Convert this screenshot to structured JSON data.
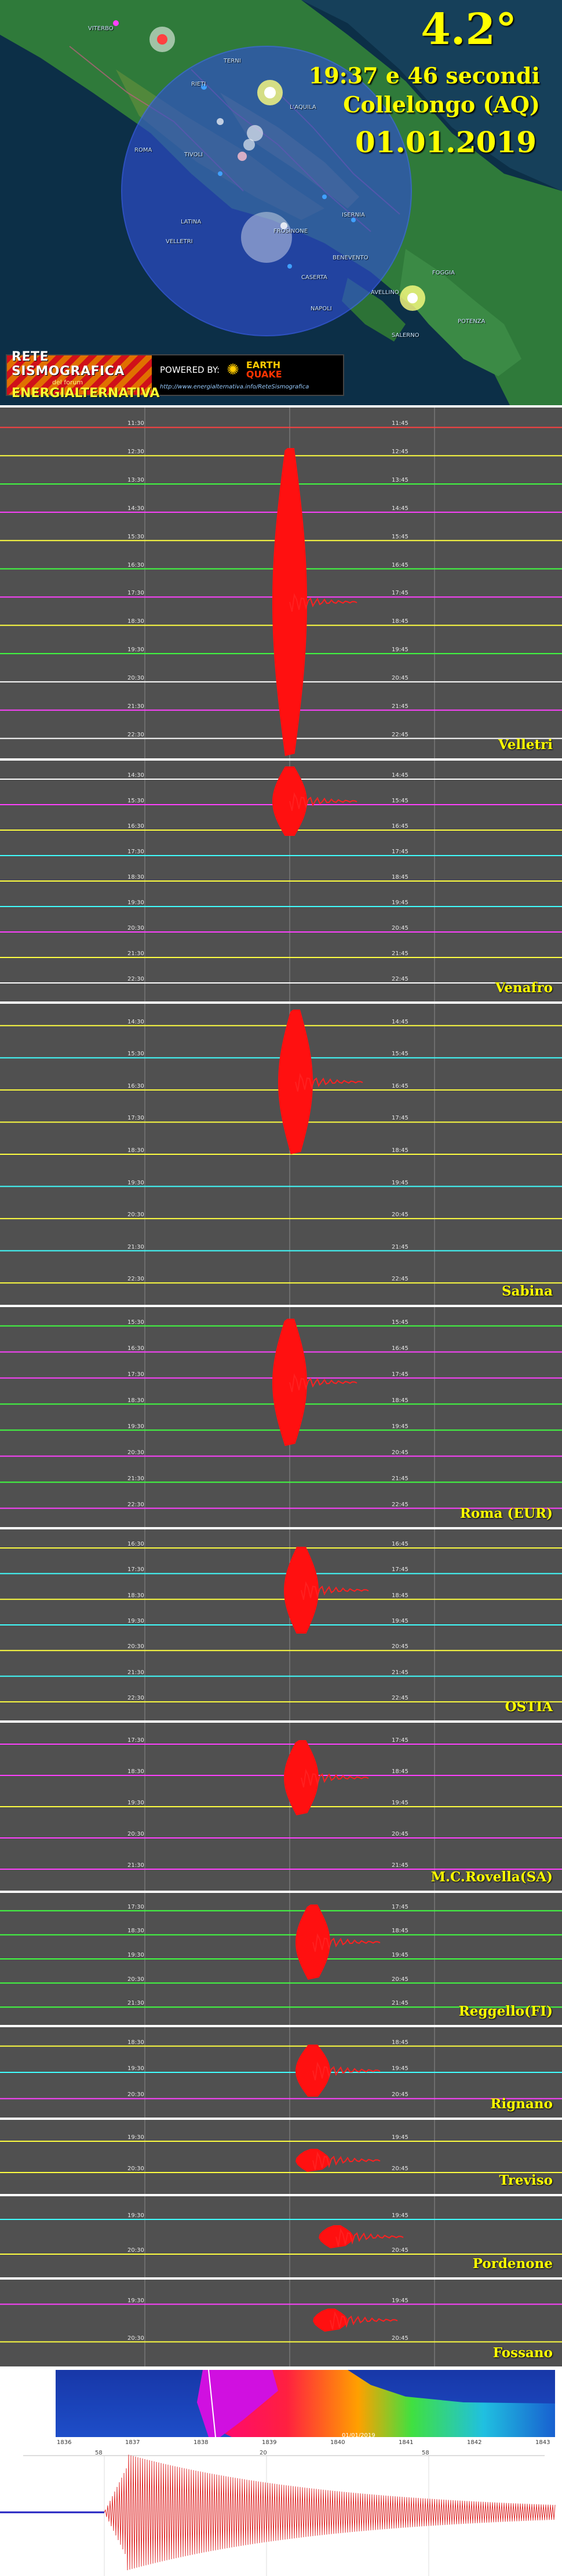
{
  "header": {
    "magnitude": "4.2°",
    "time": "19:37 e 46 secondi",
    "place": "Collelongo (AQ)",
    "date": "01.01.2019",
    "banner": {
      "logo_line1": "RETE SISMOGRAFICA",
      "logo_line2": "del forum",
      "logo_line3": "ENERGIALTERNATIVA",
      "powered_by": "POWERED BY:",
      "eq_logo_top": "EARTH",
      "eq_logo_bottom": "QUAKE",
      "url": "http://www.energialternativa.info/ReteSismografica"
    },
    "cities": [
      {
        "name": "VITERBO"
      },
      {
        "name": "TERNI"
      },
      {
        "name": "RIETI"
      },
      {
        "name": "L'AQUILA"
      },
      {
        "name": "ROMA"
      },
      {
        "name": "TIVOLI"
      },
      {
        "name": "LATINA"
      },
      {
        "name": "FROSINONE"
      },
      {
        "name": "VELLETRI"
      },
      {
        "name": "ISERNIA"
      },
      {
        "name": "BENEVENTO"
      },
      {
        "name": "CASERTA"
      },
      {
        "name": "NAPOLI"
      },
      {
        "name": "FOGGIA"
      },
      {
        "name": "AVELLINO"
      },
      {
        "name": "POTENZA"
      },
      {
        "name": "SALERNO"
      }
    ],
    "colors": {
      "mag_text": "#ffff00",
      "circle": "#2f4fd0"
    }
  },
  "stations": [
    {
      "name": "Velletri",
      "left_ticks": [
        "11:30",
        "12:30",
        "13:30",
        "14:30",
        "15:30",
        "16:30",
        "17:30",
        "18:30",
        "19:30",
        "20:30",
        "21:30",
        "22:30"
      ],
      "right_ticks": [
        "11:45",
        "12:45",
        "13:45",
        "14:45",
        "15:45",
        "16:45",
        "17:45",
        "18:45",
        "19:45",
        "20:45",
        "21:45",
        "22:45"
      ],
      "colors": [
        "#ff4040",
        "#ffff40",
        "#40ff40",
        "#ff40ff",
        "#ffff40",
        "#40ff40",
        "#ff40ff",
        "#ffff40",
        "#40ff40",
        "#ffffff",
        "#ff40ff",
        "#ffffff"
      ]
    },
    {
      "name": "Venafro",
      "left_ticks": [
        "14:30",
        "15:30",
        "16:30",
        "17:30",
        "18:30",
        "19:30",
        "20:30",
        "21:30",
        "22:30"
      ],
      "right_ticks": [
        "14:45",
        "15:45",
        "16:45",
        "17:45",
        "18:45",
        "19:45",
        "20:45",
        "21:45",
        "22:45"
      ],
      "colors": [
        "#ffffff",
        "#ff40ff",
        "#ffff40",
        "#40ffff",
        "#ffff40",
        "#40ffff",
        "#ff40ff",
        "#ffff40",
        "#ffffff"
      ]
    },
    {
      "name": "Sabina",
      "left_ticks": [
        "14:30",
        "15:30",
        "16:30",
        "17:30",
        "18:30",
        "19:30",
        "20:30",
        "21:30",
        "22:30"
      ],
      "right_ticks": [
        "14:45",
        "15:45",
        "16:45",
        "17:45",
        "18:45",
        "19:45",
        "20:45",
        "21:45",
        "22:45"
      ],
      "colors": [
        "#ffff40",
        "#40ffff",
        "#ffff40",
        "#ffff40",
        "#ffff40",
        "#40ffff",
        "#ffff40",
        "#40ffff",
        "#ffff40"
      ]
    },
    {
      "name": "Roma (EUR)",
      "left_ticks": [
        "15:30",
        "16:30",
        "17:30",
        "18:30",
        "19:30",
        "20:30",
        "21:30",
        "22:30"
      ],
      "right_ticks": [
        "15:45",
        "16:45",
        "17:45",
        "18:45",
        "19:45",
        "20:45",
        "21:45",
        "22:45"
      ],
      "colors": [
        "#40ff40",
        "#ff40ff",
        "#ff40ff",
        "#40ff40",
        "#40ff40",
        "#ff40ff",
        "#40ff40",
        "#ff40ff"
      ]
    },
    {
      "name": "OSTIA",
      "left_ticks": [
        "16:30",
        "17:30",
        "18:30",
        "19:30",
        "20:30",
        "21:30",
        "22:30"
      ],
      "right_ticks": [
        "16:45",
        "17:45",
        "18:45",
        "19:45",
        "20:45",
        "21:45",
        "22:45"
      ],
      "colors": [
        "#ffff40",
        "#40ffff",
        "#ffff40",
        "#40ffff",
        "#ffff40",
        "#40ffff",
        "#ffff40"
      ]
    },
    {
      "name": "M.C.Rovella(SA)",
      "left_ticks": [
        "17:30",
        "18:30",
        "19:30",
        "20:30",
        "21:30"
      ],
      "right_ticks": [
        "17:45",
        "18:45",
        "19:45",
        "20:45",
        "21:45"
      ],
      "colors": [
        "#ff40ff",
        "#ff40ff",
        "#ffff40",
        "#ff40ff",
        "#ff40ff"
      ]
    },
    {
      "name": "Reggello(FI)",
      "left_ticks": [
        "17:30",
        "18:30",
        "19:30",
        "20:30",
        "21:30"
      ],
      "right_ticks": [
        "17:45",
        "18:45",
        "19:45",
        "20:45",
        "21:45"
      ],
      "colors": [
        "#40ff40",
        "#40ff40",
        "#40ff40",
        "#40ff40",
        "#40ff40"
      ]
    },
    {
      "name": "Rignano",
      "left_ticks": [
        "18:30",
        "19:30",
        "20:30"
      ],
      "right_ticks": [
        "18:45",
        "19:45",
        "20:45"
      ],
      "colors": [
        "#ffff40",
        "#40ffff",
        "#ff40ff"
      ]
    },
    {
      "name": "Treviso",
      "left_ticks": [
        "19:30",
        "20:30"
      ],
      "right_ticks": [
        "19:45",
        "20:45"
      ],
      "colors": [
        "#ffff40",
        "#ffff40"
      ]
    },
    {
      "name": "Pordenone",
      "left_ticks": [
        "19:30",
        "20:30"
      ],
      "right_ticks": [
        "19:45",
        "20:45"
      ],
      "colors": [
        "#40ffff",
        "#ffff40"
      ]
    },
    {
      "name": "Fossano",
      "left_ticks": [
        "19:30",
        "20:30"
      ],
      "right_ticks": [
        "19:45",
        "20:45"
      ],
      "colors": [
        "#ff40ff",
        "#ffff40"
      ]
    }
  ],
  "spectrogram": {
    "time_ticks": [
      "1836",
      "1837",
      "1838",
      "1839",
      "1840",
      "1841",
      "1842",
      "1843"
    ],
    "stamp": "01/01/2019"
  },
  "waveform": {
    "ticks": [
      "58",
      "20",
      "58"
    ]
  }
}
